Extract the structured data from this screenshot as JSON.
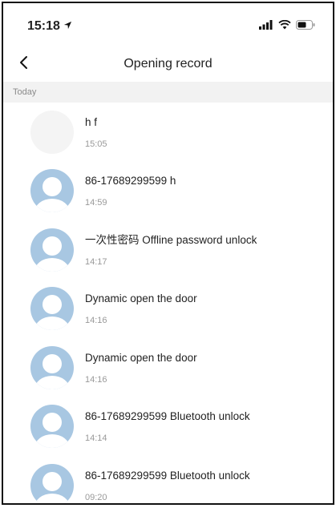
{
  "status_bar": {
    "time": "15:18"
  },
  "nav": {
    "title": "Opening record",
    "back_icon": "chevron-left-icon"
  },
  "section": {
    "label": "Today"
  },
  "records": [
    {
      "title": "h f",
      "time": "15:05",
      "avatar": "blank"
    },
    {
      "title": "86-17689299599 h",
      "time": "14:59",
      "avatar": "person"
    },
    {
      "title": "一次性密码 Offline password unlock",
      "time": "14:17",
      "avatar": "person"
    },
    {
      "title": " Dynamic open the door",
      "time": "14:16",
      "avatar": "person"
    },
    {
      "title": " Dynamic open the door",
      "time": "14:16",
      "avatar": "person"
    },
    {
      "title": "86-17689299599 Bluetooth unlock",
      "time": "14:14",
      "avatar": "person"
    },
    {
      "title": "86-17689299599 Bluetooth unlock",
      "time": "09:20",
      "avatar": "person"
    }
  ],
  "colors": {
    "avatar_bg": "#a8c7e2",
    "avatar_fg": "#ffffff",
    "section_bg": "#f2f2f2"
  }
}
